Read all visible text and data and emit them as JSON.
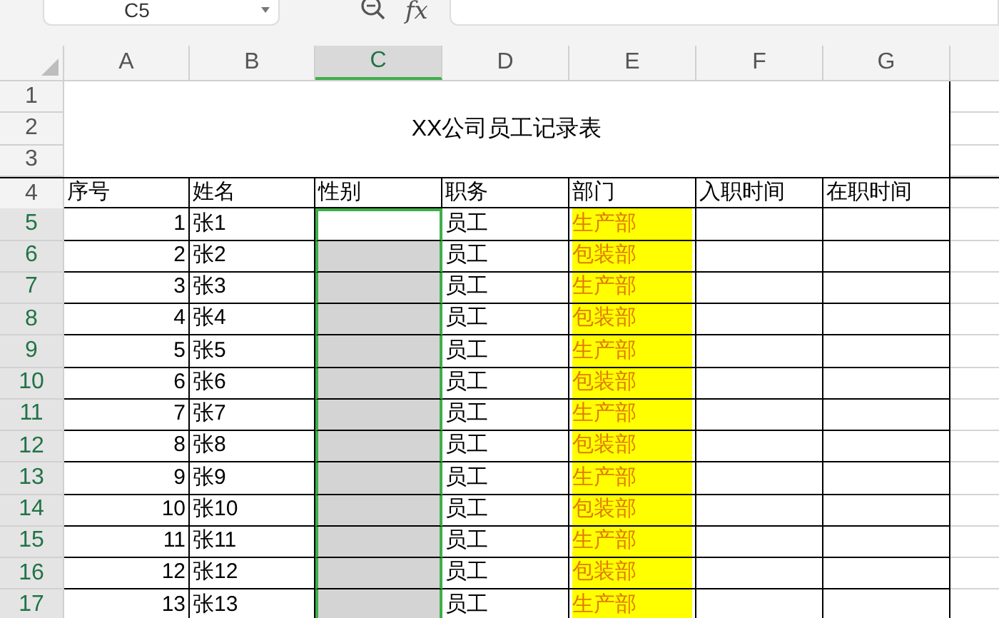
{
  "name_box": "C5",
  "formula_button": "fx",
  "columns": [
    {
      "label": "A",
      "selected": false
    },
    {
      "label": "B",
      "selected": false
    },
    {
      "label": "C",
      "selected": true
    },
    {
      "label": "D",
      "selected": false
    },
    {
      "label": "E",
      "selected": false
    },
    {
      "label": "F",
      "selected": false
    },
    {
      "label": "G",
      "selected": false
    }
  ],
  "title_rows": [
    "1",
    "2",
    "3"
  ],
  "title": "XX公司员工记录表",
  "header_row": {
    "header": "4",
    "cells": [
      "序号",
      "姓名",
      "性别",
      "职务",
      "部门",
      "入职时间",
      "在职时间"
    ]
  },
  "rows": [
    {
      "header": "5",
      "selected": true,
      "active": true,
      "no": "1",
      "name": "张1",
      "position": "员工",
      "department": "生产部"
    },
    {
      "header": "6",
      "selected": true,
      "active": false,
      "no": "2",
      "name": "张2",
      "position": "员工",
      "department": "包装部"
    },
    {
      "header": "7",
      "selected": true,
      "active": false,
      "no": "3",
      "name": "张3",
      "position": "员工",
      "department": "生产部"
    },
    {
      "header": "8",
      "selected": true,
      "active": false,
      "no": "4",
      "name": "张4",
      "position": "员工",
      "department": "包装部"
    },
    {
      "header": "9",
      "selected": true,
      "active": false,
      "no": "5",
      "name": "张5",
      "position": "员工",
      "department": "生产部"
    },
    {
      "header": "10",
      "selected": true,
      "active": false,
      "no": "6",
      "name": "张6",
      "position": "员工",
      "department": "包装部"
    },
    {
      "header": "11",
      "selected": true,
      "active": false,
      "no": "7",
      "name": "张7",
      "position": "员工",
      "department": "生产部"
    },
    {
      "header": "12",
      "selected": true,
      "active": false,
      "no": "8",
      "name": "张8",
      "position": "员工",
      "department": "包装部"
    },
    {
      "header": "13",
      "selected": true,
      "active": false,
      "no": "9",
      "name": "张9",
      "position": "员工",
      "department": "生产部"
    },
    {
      "header": "14",
      "selected": true,
      "active": false,
      "no": "10",
      "name": "张10",
      "position": "员工",
      "department": "包装部"
    },
    {
      "header": "15",
      "selected": true,
      "active": false,
      "no": "11",
      "name": "张11",
      "position": "员工",
      "department": "生产部"
    },
    {
      "header": "16",
      "selected": true,
      "active": false,
      "no": "12",
      "name": "张12",
      "position": "员工",
      "department": "包装部"
    },
    {
      "header": "17",
      "selected": true,
      "active": false,
      "no": "13",
      "name": "张13",
      "position": "员工",
      "department": "生产部"
    }
  ]
}
